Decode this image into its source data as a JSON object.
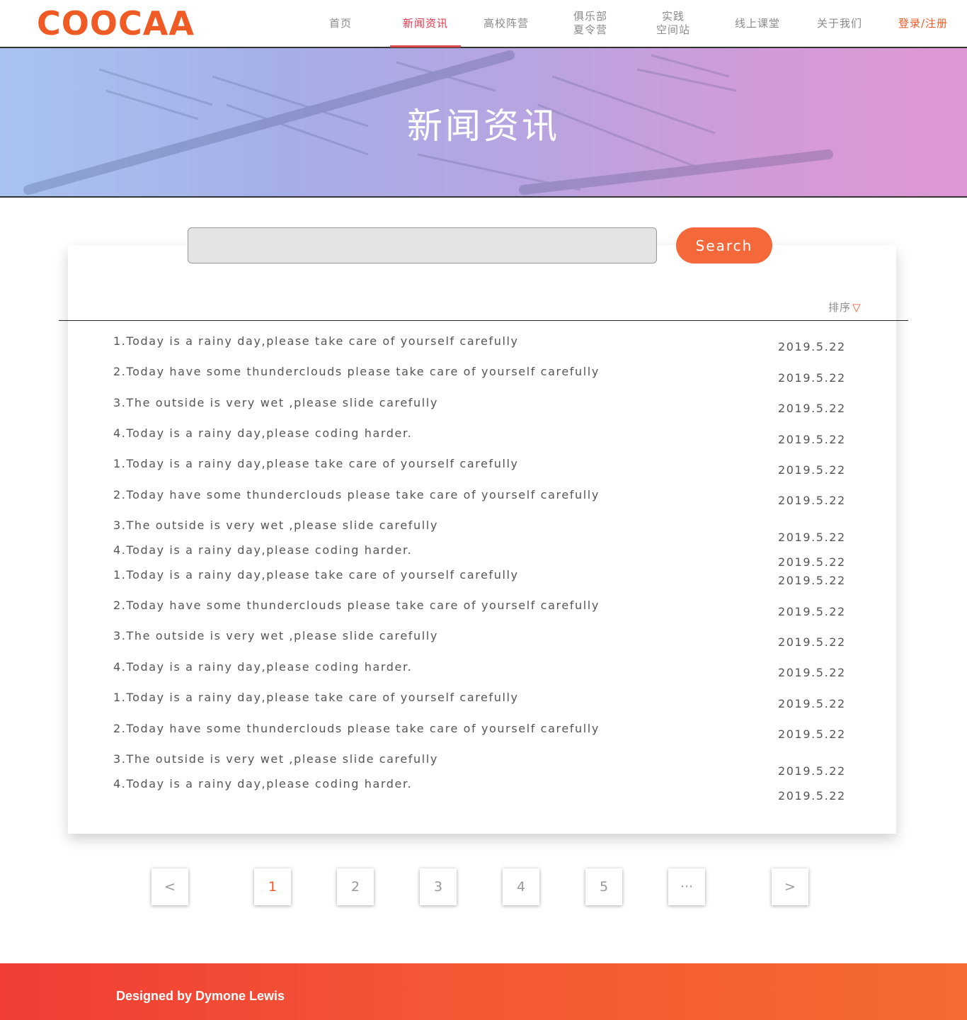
{
  "header": {
    "logo": "COOCAA",
    "nav": [
      {
        "label": "首页"
      },
      {
        "label": "新闻资讯"
      },
      {
        "label": "高校阵营"
      },
      {
        "label": "俱乐部\n夏令营"
      },
      {
        "label": "实践\n空间站"
      },
      {
        "label": "线上课堂"
      },
      {
        "label": "关于我们"
      },
      {
        "label": "登录/注册"
      }
    ]
  },
  "banner": {
    "title": "新闻资讯"
  },
  "search": {
    "placeholder": "",
    "value": "",
    "button_label": "Search"
  },
  "sort": {
    "label": "排序",
    "icon": "triangle-down-icon",
    "icon_glyph": "▽"
  },
  "news": [
    {
      "title": "1.Today is a rainy day,please take care of  yourself carefully",
      "date": "2019.5.22"
    },
    {
      "title": "2.Today have some thunderclouds please take care of  yourself carefully",
      "date": "2019.5.22"
    },
    {
      "title": "3.The outside is very wet ,please slide carefully",
      "date": "2019.5.22"
    },
    {
      "title": "4.Today is a rainy day,please coding harder.",
      "date": "2019.5.22"
    },
    {
      "title": "1.Today is a rainy day,please take care of  yourself carefully",
      "date": "2019.5.22"
    },
    {
      "title": "2.Today have some thunderclouds please take care of  yourself carefully",
      "date": "2019.5.22"
    },
    {
      "title": "3.The outside is very wet ,please slide carefully",
      "date": "2019.5.22"
    },
    {
      "title": "4.Today is a rainy day,please coding harder.",
      "date": "2019.5.22"
    },
    {
      "title": "1.Today is a rainy day,please take care of  yourself carefully",
      "date": "2019.5.22"
    },
    {
      "title": "2.Today have some thunderclouds please take care of  yourself carefully",
      "date": "2019.5.22"
    },
    {
      "title": "3.The outside is very wet ,please slide carefully",
      "date": "2019.5.22"
    },
    {
      "title": "4.Today is a rainy day,please coding harder.",
      "date": "2019.5.22"
    },
    {
      "title": "1.Today is a rainy day,please take care of  yourself carefully",
      "date": "2019.5.22"
    },
    {
      "title": "2.Today have some thunderclouds please take care of  yourself carefully",
      "date": "2019.5.22"
    },
    {
      "title": "3.The outside is very wet ,please slide carefully",
      "date": "2019.5.22"
    },
    {
      "title": "4.Today is a rainy day,please coding harder.",
      "date": "2019.5.22"
    }
  ],
  "pagination": {
    "prev": "<",
    "pages": [
      "1",
      "2",
      "3",
      "4",
      "5",
      "···"
    ],
    "next": ">",
    "current": "1"
  },
  "footer": {
    "text": "Designed by Dymone Lewis"
  },
  "colors": {
    "accent": "#f05a24",
    "active_nav": "#e8334a",
    "button": "#f5683a"
  }
}
